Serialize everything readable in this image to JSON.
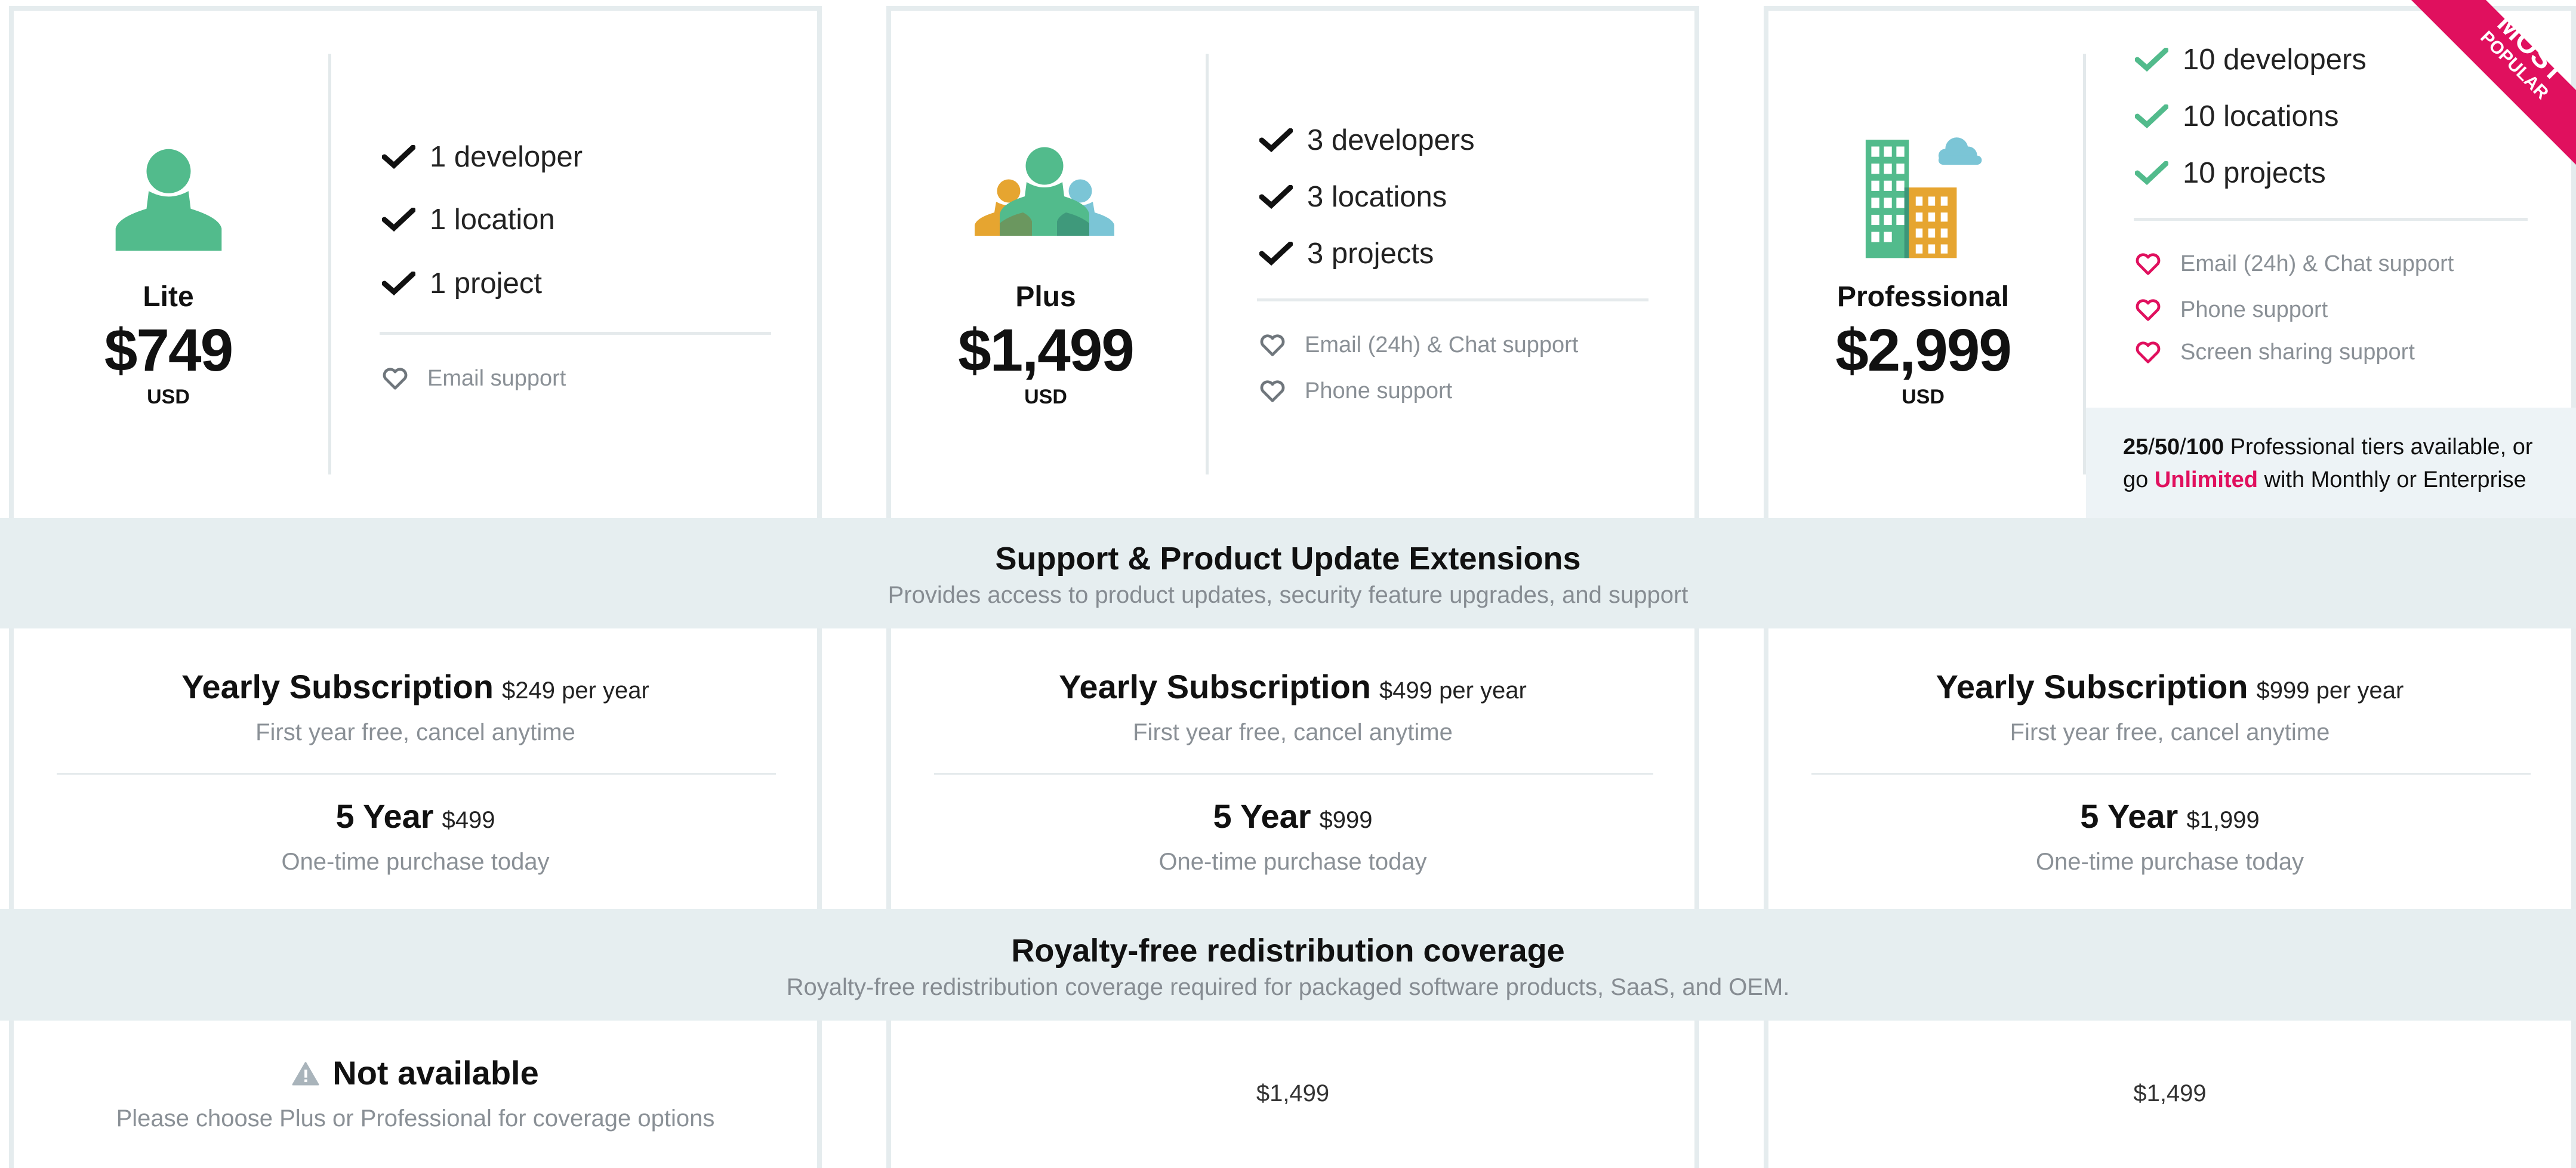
{
  "plans": [
    {
      "name": "Lite",
      "price": "$749",
      "currency": "USD",
      "features": [
        "1 developer",
        "1 location",
        "1 project"
      ],
      "support": [
        "Email support"
      ]
    },
    {
      "name": "Plus",
      "price": "$1,499",
      "currency": "USD",
      "features": [
        "3 developers",
        "3 locations",
        "3 projects"
      ],
      "support": [
        "Email (24h) & Chat support",
        "Phone support"
      ]
    },
    {
      "name": "Professional",
      "price": "$2,999",
      "currency": "USD",
      "ribbon": {
        "line1": "MOST",
        "line2": "POPULAR"
      },
      "features": [
        "10 developers",
        "10 locations",
        "10 projects"
      ],
      "support": [
        "Email (24h) & Chat support",
        "Phone support",
        "Screen sharing support"
      ],
      "tiers_note": {
        "tier_1": "25",
        "sep_1": "/",
        "tier_2": "50",
        "sep_2": "/",
        "tier_3": "100",
        "text_1": " Professional tiers available, or",
        "text_2": "go ",
        "highlight": "Unlimited",
        "text_3": " with Monthly or Enterprise"
      }
    }
  ],
  "support_band": {
    "title": "Support & Product Update Extensions",
    "subtitle": "Provides access to product updates, security feature upgrades, and support"
  },
  "subscriptions": [
    {
      "yearly_label": "Yearly Subscription",
      "yearly_price": "$249 per year",
      "yearly_note": "First year free, cancel anytime",
      "five_label": "5 Year",
      "five_price": "$499",
      "five_note": "One-time purchase today"
    },
    {
      "yearly_label": "Yearly Subscription",
      "yearly_price": "$499 per year",
      "yearly_note": "First year free, cancel anytime",
      "five_label": "5 Year",
      "five_price": "$999",
      "five_note": "One-time purchase today"
    },
    {
      "yearly_label": "Yearly Subscription",
      "yearly_price": "$999 per year",
      "yearly_note": "First year free, cancel anytime",
      "five_label": "5 Year",
      "five_price": "$1,999",
      "five_note": "One-time purchase today"
    }
  ],
  "royalty_band": {
    "title": "Royalty-free redistribution coverage",
    "subtitle": "Royalty-free redistribution coverage required for packaged software products, SaaS, and OEM."
  },
  "coverage": [
    {
      "status": "Not available",
      "note": "Please choose Plus or Professional for coverage options",
      "icon": "warning-icon"
    },
    {
      "price": "$1,499"
    },
    {
      "price": "$1,499"
    }
  ],
  "colors": {
    "green": "#52bb8c",
    "orange": "#e6a530",
    "blue": "#7bc5d6",
    "pink": "#e0105e",
    "band": "#e6eef0",
    "border": "#e5ecee"
  },
  "icons": {
    "lite": "single-user-icon",
    "plus": "user-group-icon",
    "professional": "building-cloud-icon",
    "feature": "checkmark-icon",
    "support": "heart-icon"
  }
}
